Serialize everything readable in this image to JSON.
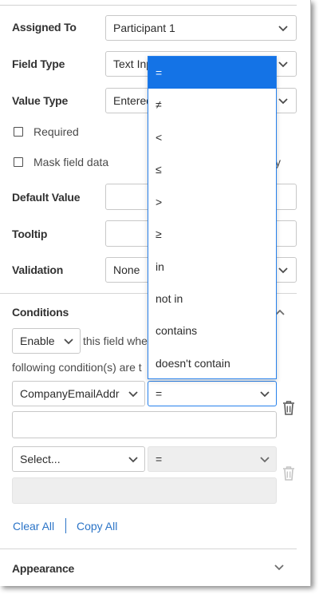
{
  "form": {
    "assigned_to": {
      "label": "Assigned To",
      "value": "Participant 1"
    },
    "field_type": {
      "label": "Field Type",
      "value": "Text Input"
    },
    "value_type": {
      "label": "Value Type",
      "value": "Entered"
    },
    "required": {
      "label": "Required",
      "checked": false
    },
    "mask": {
      "label": "Mask field data",
      "checked": false
    },
    "mask_suffix": "y",
    "default_value": {
      "label": "Default Value",
      "value": ""
    },
    "tooltip": {
      "label": "Tooltip",
      "value": ""
    },
    "validation": {
      "label": "Validation",
      "value": "None"
    }
  },
  "conditions": {
    "title": "Conditions",
    "mode": "Enable",
    "sentence_part1": "this field whe",
    "sentence_part2": "following condition(s) are t",
    "rows": [
      {
        "field": "CompanyEmailAddr",
        "operator": "=",
        "value": ""
      },
      {
        "field": "Select...",
        "operator": "=",
        "value": ""
      }
    ],
    "clear_all": "Clear All",
    "copy_all": "Copy All"
  },
  "appearance": {
    "title": "Appearance"
  },
  "operator_dropdown": {
    "selected_index": 0,
    "options": [
      "=",
      "≠",
      "<",
      "≤",
      ">",
      "≥",
      "in",
      "not in",
      "contains",
      "doesn't contain"
    ]
  },
  "colors": {
    "accent": "#1473e6",
    "focus_border": "#2680eb",
    "link": "#2b74c7",
    "disabled_field": "#eeeeee"
  }
}
